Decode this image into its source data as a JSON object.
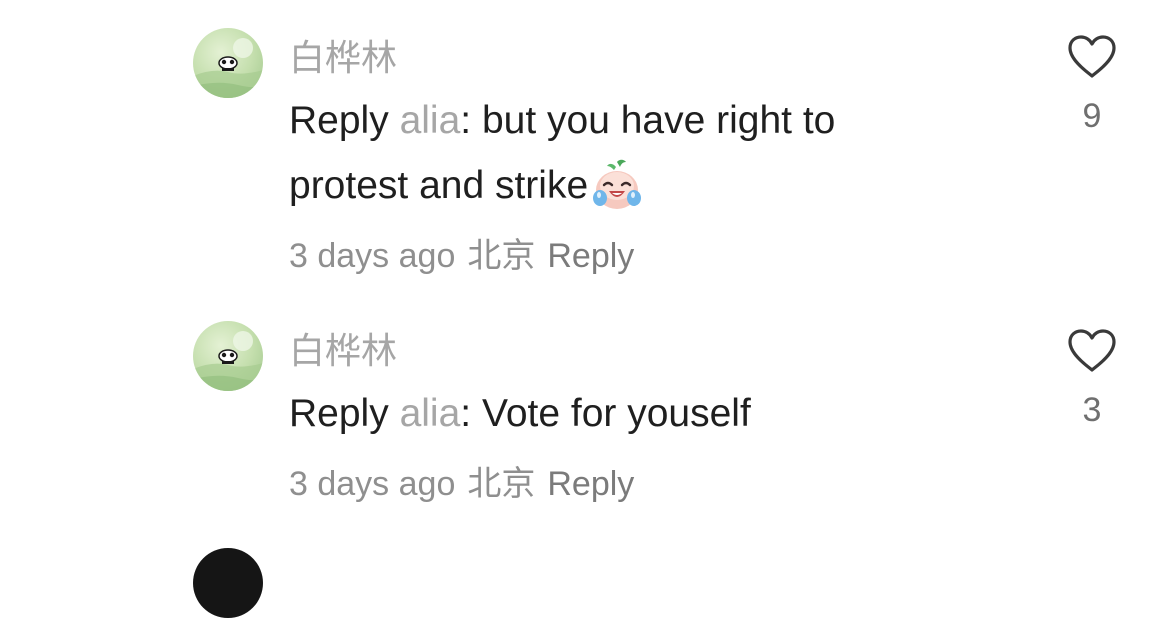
{
  "comments": [
    {
      "username": "白桦林",
      "reply_word": "Reply",
      "mention": "alia",
      "text": ": but you have right to protest and strike",
      "emoji": "crying-laughing-emoji",
      "time": "3 days ago",
      "location": "北京",
      "reply_label": "Reply",
      "likes": "9"
    },
    {
      "username": "白桦林",
      "reply_word": "Reply",
      "mention": "alia",
      "text": ": Vote for youself",
      "time": "3 days ago",
      "location": "北京",
      "reply_label": "Reply",
      "likes": "3"
    }
  ],
  "colors": {
    "username": "#a6a6a6",
    "mention": "#a6a6a6",
    "meta": "#8f8f8f",
    "text": "#1f1f1f",
    "avatar_green": "#c9e3b4"
  }
}
